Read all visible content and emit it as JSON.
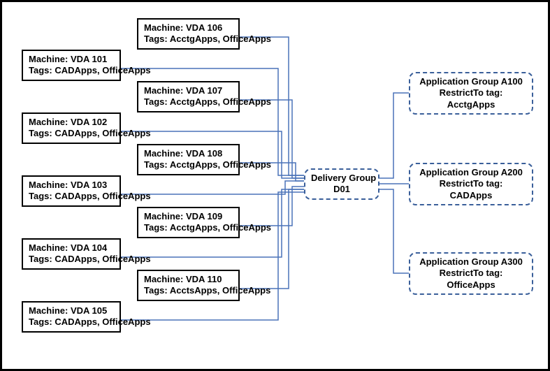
{
  "vda_left": [
    {
      "name": "VDA 101",
      "tags": "CADApps, OfficeApps"
    },
    {
      "name": "VDA 102",
      "tags": "CADApps, OfficeApps"
    },
    {
      "name": "VDA 103",
      "tags": "CADApps, OfficeApps"
    },
    {
      "name": "VDA 104",
      "tags": "CADApps, OfficeApps"
    },
    {
      "name": "VDA 105",
      "tags": "CADApps, OfficeApps"
    }
  ],
  "vda_right": [
    {
      "name": "VDA 106",
      "tags": "AcctgApps, OfficeApps"
    },
    {
      "name": "VDA 107",
      "tags": "AcctgApps, OfficeApps"
    },
    {
      "name": "VDA 108",
      "tags": "AcctgApps, OfficeApps"
    },
    {
      "name": "VDA 109",
      "tags": "AcctgApps, OfficeApps"
    },
    {
      "name": "VDA 110",
      "tags": "AcctsApps, OfficeApps"
    }
  ],
  "labels": {
    "machine_prefix": "Machine: ",
    "tags_prefix": "Tags: "
  },
  "delivery_group": {
    "line1": "Delivery Group",
    "line2": "D01"
  },
  "app_groups": [
    {
      "name": "Application Group A100",
      "restrict_label": "RestrictTo tag:",
      "restrict_value": "AcctgApps"
    },
    {
      "name": "Application Group A200",
      "restrict_label": "RestrictTo tag:",
      "restrict_value": "CADApps"
    },
    {
      "name": "Application Group A300",
      "restrict_label": "RestrictTo tag:",
      "restrict_value": "OfficeApps"
    }
  ]
}
